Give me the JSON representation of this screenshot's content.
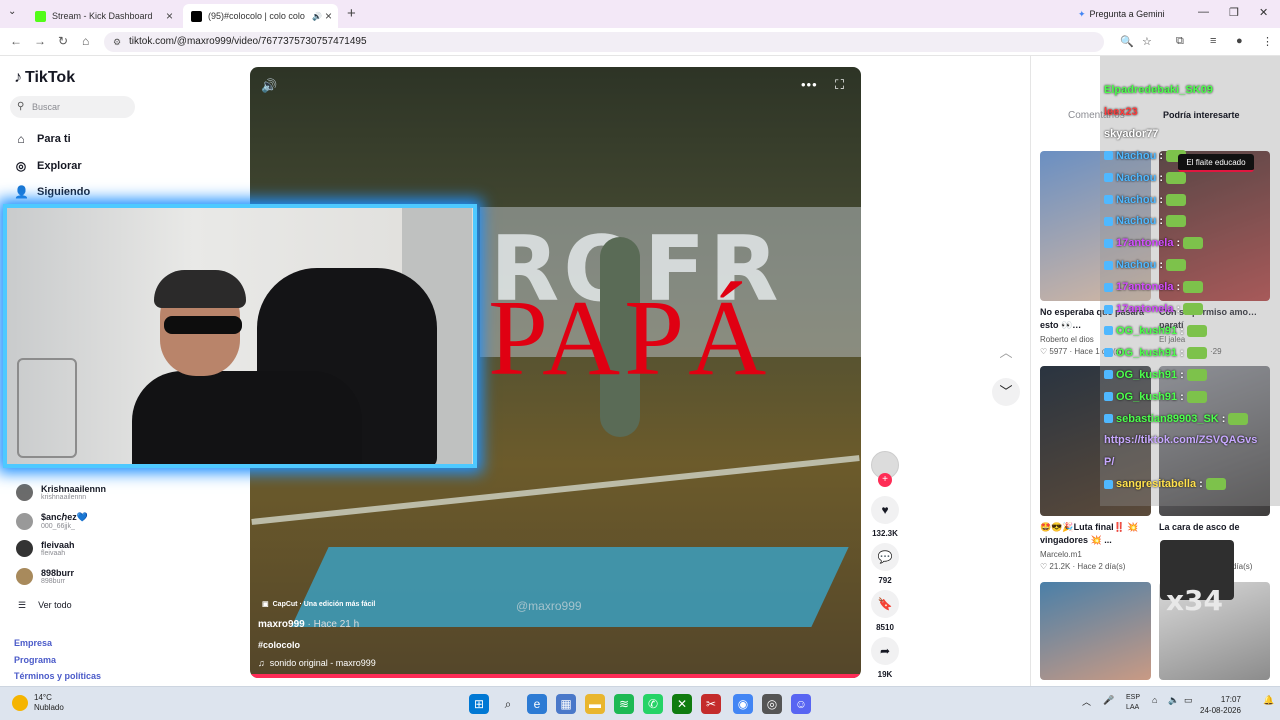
{
  "browser": {
    "tabs": [
      {
        "title": "Stream - Kick Dashboard",
        "favicon_color": "#53fc18"
      },
      {
        "title": "(95)#colocolo | colo colo | T",
        "favicon_color": "#000000"
      }
    ],
    "gemini_label": "Pregunta a Gemini",
    "url": "tiktok.com/@maxro999/video/7677375730757471495"
  },
  "sidebar": {
    "logo": "TikTok",
    "search_placeholder": "Buscar",
    "nav": [
      {
        "label": "Para ti",
        "icon": "home-icon"
      },
      {
        "label": "Explorar",
        "icon": "compass-icon"
      },
      {
        "label": "Siguiendo",
        "icon": "users-icon"
      }
    ],
    "accounts": [
      {
        "name": "Krishnaailennn",
        "handle": "krishnaailennn"
      },
      {
        "name": "$ancℎez💙",
        "handle": "000_66jjk_"
      },
      {
        "name": "fleivaah",
        "handle": "fleivaah"
      },
      {
        "name": "898burr",
        "handle": "898burr"
      }
    ],
    "ver_todo": "Ver todo",
    "footer": [
      "Empresa",
      "Programa",
      "Términos y políticas"
    ]
  },
  "video": {
    "capcut": "CapCut · Una edición más fácil",
    "author": "maxro999",
    "time": "· Hace 21 h",
    "hashtag": "#colocolo",
    "sound": "sonido original - maxro999",
    "overlay_text": "PAPÁ",
    "banner_text": "ROFR",
    "watermark": "@maxro999"
  },
  "actions": {
    "likes": "132.3K",
    "comments": "792",
    "saves": "8510",
    "shares": "19K"
  },
  "right": {
    "comments_tab": "Comentarios",
    "podria": "Podría interesarte",
    "pill": "El flaite educado",
    "videos": [
      {
        "title": "No esperaba que pasara esto 👀…",
        "author": "Roberto el dios",
        "likes": "5977",
        "time": "· Hace 1 día(s)"
      },
      {
        "title": "Con su permiso amo…paratí",
        "author": "El jalea",
        "likes": "",
        "time": "·29"
      },
      {
        "title": "🤩😎🎉Luta final‼️ 💥 vingadores 💥 ...",
        "author": "Marcelo.m1",
        "likes": "21.2K",
        "time": "· Hace 2 día(s)"
      },
      {
        "title": "La cara de asco de",
        "author": "",
        "likes": "",
        "time": "día(s)"
      }
    ],
    "x34": "x34"
  },
  "chat": [
    {
      "user": "Elpadredebaki_SK09",
      "text": "",
      "color": "#4cff4c"
    },
    {
      "user": "leex23",
      "text": "",
      "color": "#ff3b3b"
    },
    {
      "user": "skyador77",
      "text": "",
      "color": "#ffffff"
    },
    {
      "user": "Nachou",
      "text": ":",
      "color": "#4fb8ff"
    },
    {
      "user": "Nachou",
      "text": ":",
      "color": "#4fb8ff"
    },
    {
      "user": "Nachou",
      "text": ":",
      "color": "#4fb8ff"
    },
    {
      "user": "Nachou",
      "text": ":",
      "color": "#4fb8ff"
    },
    {
      "user": "17antonela",
      "text": ":",
      "color": "#d34cff"
    },
    {
      "user": "Nachou",
      "text": ":",
      "color": "#4fb8ff"
    },
    {
      "user": "17antonela",
      "text": ":",
      "color": "#d34cff"
    },
    {
      "user": "17antonela",
      "text": ":",
      "color": "#d34cff"
    },
    {
      "user": "OG_kush91",
      "text": ":",
      "color": "#4cff4c"
    },
    {
      "user": "OG_kush91",
      "text": ":",
      "color": "#4cff4c"
    },
    {
      "user": "OG_kush91",
      "text": ":",
      "color": "#4cff4c"
    },
    {
      "user": "OG_kush91",
      "text": ":",
      "color": "#4cff4c"
    },
    {
      "user": "sebastian89903_SK",
      "text": ":",
      "color": "#4cff4c"
    },
    {
      "user": "https://tiktok.com/ZSVQAGvs",
      "text": "",
      "color": "#c7a8ff"
    },
    {
      "user": "P/",
      "text": "",
      "color": "#c7a8ff"
    },
    {
      "user": "sangresitabella",
      "text": ":",
      "color": "#ffe14c"
    }
  ],
  "taskbar": {
    "temp": "14°C",
    "weather": "Nublado",
    "lang1": "ESP",
    "lang2": "LAA",
    "time": "17:07",
    "date": "24-08-2026"
  }
}
